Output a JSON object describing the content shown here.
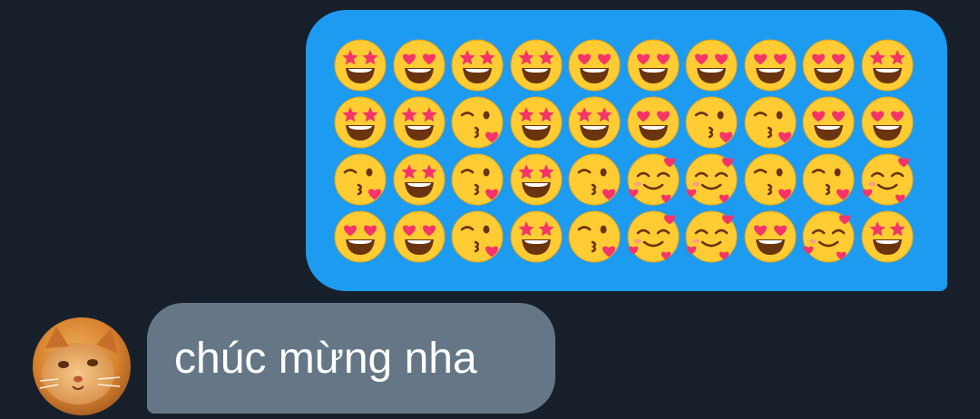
{
  "outgoing_message": {
    "emojis": [
      [
        "star-struck",
        "heart-eyes",
        "star-struck",
        "star-struck",
        "heart-eyes",
        "heart-eyes",
        "heart-eyes",
        "heart-eyes",
        "heart-eyes",
        "star-struck"
      ],
      [
        "star-struck",
        "star-struck",
        "kissing-heart",
        "star-struck",
        "star-struck",
        "heart-eyes",
        "kissing-heart",
        "kissing-heart",
        "heart-eyes",
        "heart-eyes"
      ],
      [
        "kissing-heart",
        "star-struck",
        "kissing-heart",
        "star-struck",
        "kissing-heart",
        "smiling-hearts",
        "smiling-hearts",
        "kissing-heart",
        "kissing-heart",
        "smiling-hearts"
      ],
      [
        "heart-eyes",
        "heart-eyes",
        "kissing-heart",
        "star-struck",
        "kissing-heart",
        "smiling-hearts",
        "smiling-hearts",
        "heart-eyes",
        "smiling-hearts",
        "star-struck"
      ]
    ],
    "bubble_color": "#1d9bf0"
  },
  "incoming_message": {
    "text": "chúc mừng nha",
    "bubble_color": "#657786",
    "sender_avatar_icon": "cat-avatar"
  },
  "theme": {
    "background": "#17202a",
    "emoji_face": "#ffcc33",
    "emoji_accent": "#f5346a"
  }
}
